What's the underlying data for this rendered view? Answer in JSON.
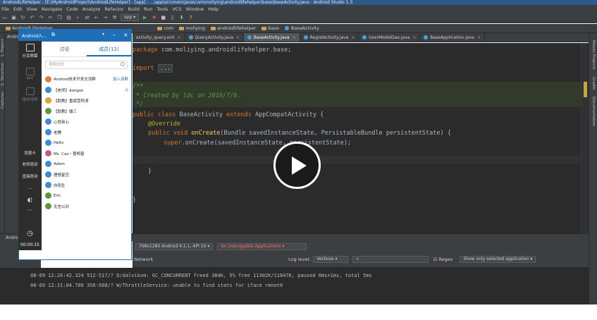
{
  "window": {
    "title": "AndroidLifeHelper - [E:\\MyAndroidProject\\AndroidLifeHelper] - [app] - ...\\app\\src\\main\\java\\com\\moliying\\androidlifehelper\\base\\BaseActivity.java - Android Studio 1.3"
  },
  "menu": [
    "File",
    "Edit",
    "View",
    "Navigate",
    "Code",
    "Analyze",
    "Refactor",
    "Build",
    "Run",
    "Tools",
    "VCS",
    "Window",
    "Help"
  ],
  "toolbar": {
    "config_label": "app",
    "icons": [
      "folder-icon",
      "save-icon",
      "sync-icon",
      "undo-icon",
      "redo-icon",
      "cut-icon",
      "copy-icon",
      "paste-icon",
      "search-icon",
      "replace-icon",
      "back-icon",
      "forward-icon",
      "build-icon",
      "run-icon",
      "debug-icon",
      "stop-icon",
      "avd-icon",
      "sdk-icon",
      "help-icon"
    ]
  },
  "nav": {
    "project_root": "AndroidLifeHelper",
    "crumbs": [
      "com",
      "moliying",
      "androidlifehelper",
      "base",
      "BaseActivity"
    ]
  },
  "tabs": [
    {
      "label": "activity_query.xml",
      "active": false
    },
    {
      "label": "QueryActivity.java",
      "active": false
    },
    {
      "label": "BaseActivity.java",
      "active": true
    },
    {
      "label": "RegistActivity.java",
      "active": false
    },
    {
      "label": "UserModelDao.java",
      "active": false
    },
    {
      "label": "BaseApplication.java",
      "active": false
    }
  ],
  "code": {
    "line1_kw": "package",
    "line1_rest": " com.moliying.androidlifehelper.base;",
    "line2_kw": "import",
    "line2_fold": "...",
    "cmt1": "/**",
    "cmt2": " * Created by ldc on 2016/7/6.",
    "cmt3": " */",
    "cls_kw1": "public class",
    "cls_name": " BaseActivity ",
    "cls_kw2": "extends",
    "cls_parent": " AppCompatActivity {",
    "annotation": "@Override",
    "m_kw": "public void",
    "m_name": " onCreate",
    "m_args": "(Bundle savedInstanceState, PersistableBundle persistentState) {",
    "super_kw": "super",
    "super_rest": ".onCreate(savedInstanceState, persistentState);",
    "close1": "}",
    "close2": "}"
  },
  "right_tools": [
    "Maven Projects",
    "Gradle",
    "Documentation"
  ],
  "left_tools": [
    "1: Project",
    "2: Structure",
    "Captures"
  ],
  "bottom": {
    "android_tab": "Android",
    "device": "768x1280 Android 4.1.1, API 16",
    "process": "No Debuggable Applications",
    "log_level_label": "Log level:",
    "log_level": "Verbose",
    "search_placeholder": "",
    "regex_label": "Regex",
    "filter": "Show only selected application",
    "network_label": "Network"
  },
  "logs": [
    "08-09 12:26:42.324 512-517/? D/dalvikvm: GC_CONCURRENT freed 384K, 5% free 11302K/11847K, paused 0ms+1ms, total 5ms",
    "08-09 12:31:04.780 356-508/? W/ThrottleService: unable to find stats for iface rmnet0"
  ],
  "recorder": {
    "items": [
      {
        "label": "分享屏幕",
        "dim": false
      },
      {
        "label": "PPT",
        "dim": true
      },
      {
        "label": "播放视频",
        "dim": true
      }
    ],
    "side_labels": [
      "答题卡",
      "老师提讲",
      "直接提讲"
    ],
    "time": "00:00:15"
  },
  "qq": {
    "title": "Android入...",
    "tabs": [
      "讨论",
      "成员(12)"
    ],
    "search_placeholder": "搜索成员",
    "members": [
      {
        "name": "Android技术开发交流群",
        "badge": "加入该群",
        "color": "#e07b39"
      },
      {
        "name": "【老师】dongox",
        "badge": "◎",
        "color": "#3b8ad9"
      },
      {
        "name": "【助教】重磅营阿涛",
        "badge": "",
        "color": "#d9a23b"
      },
      {
        "name": "【助教】璐三",
        "badge": "",
        "color": "#5a9a3b"
      },
      {
        "name": "心悦英心",
        "badge": "",
        "color": "#3b8ad9"
      },
      {
        "name": "老腾",
        "badge": "",
        "color": "#3b8ad9"
      },
      {
        "name": "Hello",
        "badge": "",
        "color": "#3b8ad9"
      },
      {
        "name": "Ms. Cao丶蕾明普",
        "badge": "",
        "color": "#c85a8a"
      },
      {
        "name": "Adam",
        "badge": "",
        "color": "#3b8ad9"
      },
      {
        "name": "理想星空",
        "badge": "",
        "color": "#3b8ad9"
      },
      {
        "name": "向阳生",
        "badge": "",
        "color": "#3b8ad9"
      },
      {
        "name": "Eric",
        "badge": "",
        "color": "#5a9a3b"
      },
      {
        "name": "无言以对",
        "badge": "",
        "color": "#5a9a3b"
      }
    ]
  },
  "colors": {
    "accent": "#1e6fb8",
    "editor_bg": "#2b2b2b",
    "ide_panel": "#3c3f41"
  }
}
